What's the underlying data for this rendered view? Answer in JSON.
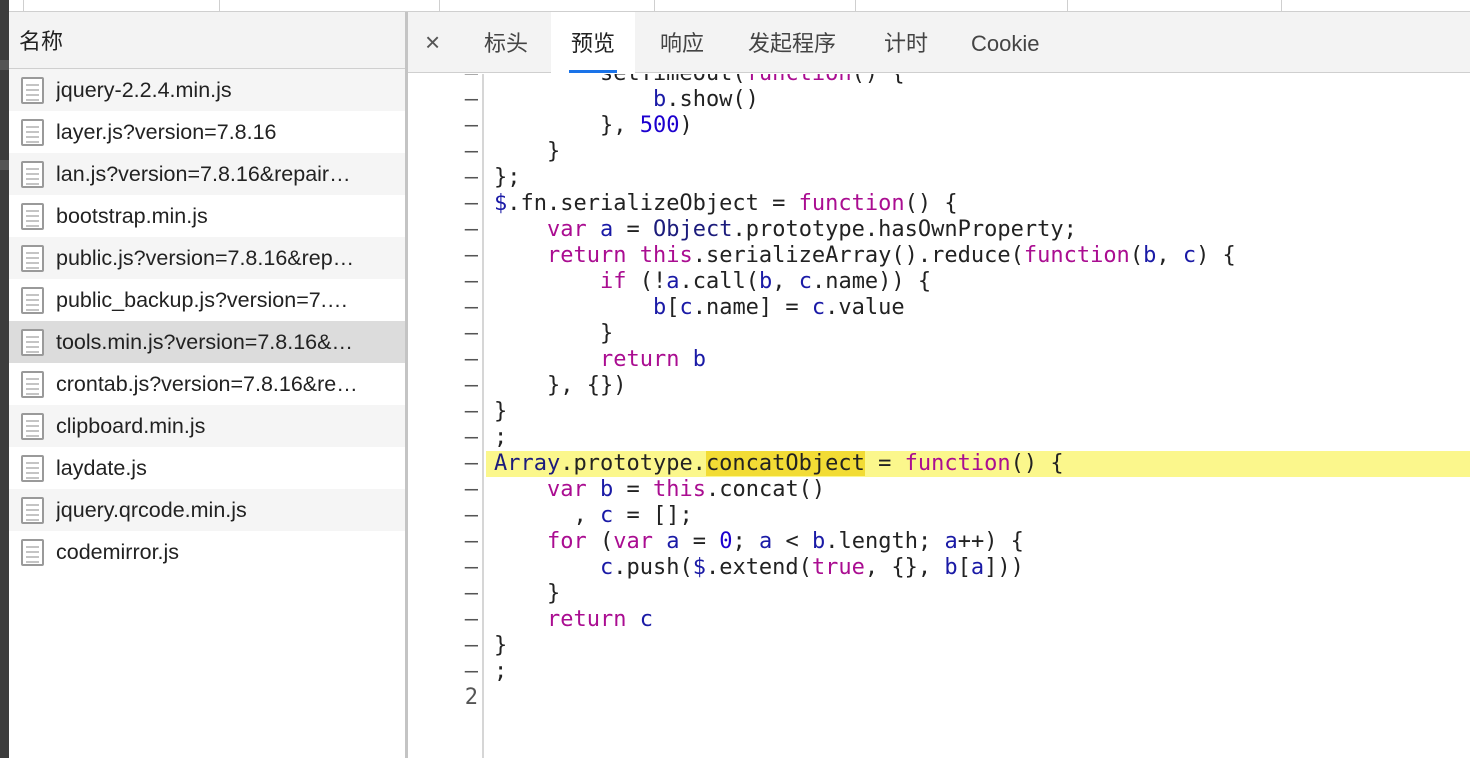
{
  "network_list": {
    "header": "名称",
    "files": [
      {
        "name": "jquery-2.2.4.min.js"
      },
      {
        "name": "layer.js?version=7.8.16"
      },
      {
        "name": "lan.js?version=7.8.16&repair…"
      },
      {
        "name": "bootstrap.min.js"
      },
      {
        "name": "public.js?version=7.8.16&rep…"
      },
      {
        "name": "public_backup.js?version=7.…"
      },
      {
        "name": "tools.min.js?version=7.8.16&…"
      },
      {
        "name": "crontab.js?version=7.8.16&re…"
      },
      {
        "name": "clipboard.min.js"
      },
      {
        "name": "laydate.js"
      },
      {
        "name": "jquery.qrcode.min.js"
      },
      {
        "name": "codemirror.js"
      }
    ],
    "selected_index": 6
  },
  "preview": {
    "close_icon": "×",
    "tabs": [
      "标头",
      "预览",
      "响应",
      "发起程序",
      "计时",
      "Cookie"
    ],
    "active_tab": "预览"
  },
  "code": {
    "gutter_dash": "–",
    "last_line_number": "2",
    "highlighted_line": 15,
    "search_match": "concatObject",
    "lines": [
      "        setTimeout(function() {",
      "            b.show()",
      "        }, 500)",
      "    }",
      "};",
      "$.fn.serializeObject = function() {",
      "    var a = Object.prototype.hasOwnProperty;",
      "    return this.serializeArray().reduce(function(b, c) {",
      "        if (!a.call(b, c.name)) {",
      "            b[c.name] = c.value",
      "        }",
      "        return b",
      "    }, {})",
      "}",
      ";",
      "Array.prototype.concatObject = function() {",
      "    var b = this.concat()",
      "      , c = [];",
      "    for (var a = 0; a < b.length; a++) {",
      "        c.push($.extend(true, {}, b[a]))",
      "    }",
      "    return c",
      "}",
      ";",
      ""
    ]
  }
}
